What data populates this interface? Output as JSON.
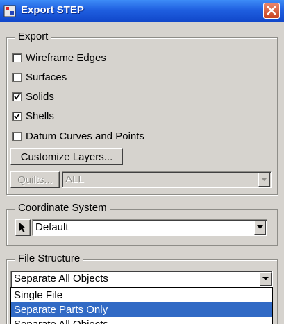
{
  "window": {
    "title": "Export STEP",
    "icon": "pro-e-app-icon"
  },
  "export_group": {
    "legend": "Export",
    "options": [
      {
        "label": "Wireframe Edges",
        "checked": false
      },
      {
        "label": "Surfaces",
        "checked": false
      },
      {
        "label": "Solids",
        "checked": true
      },
      {
        "label": "Shells",
        "checked": true
      },
      {
        "label": "Datum Curves and Points",
        "checked": false
      }
    ],
    "customize_layers_label": "Customize Layers...",
    "quilts_label": "Quilts...",
    "quilts_value": "ALL"
  },
  "coordinate_system": {
    "legend": "Coordinate System",
    "value": "Default"
  },
  "file_structure": {
    "legend": "File Structure",
    "value": "Separate All Objects",
    "options": [
      "Single File",
      "Separate Parts Only",
      "Separate All Objects"
    ],
    "highlighted_option": "Separate Parts Only"
  },
  "colors": {
    "titlebar": "#1f5fe0",
    "dialog_bg": "#d6d3ce",
    "selection": "#316ac5"
  }
}
